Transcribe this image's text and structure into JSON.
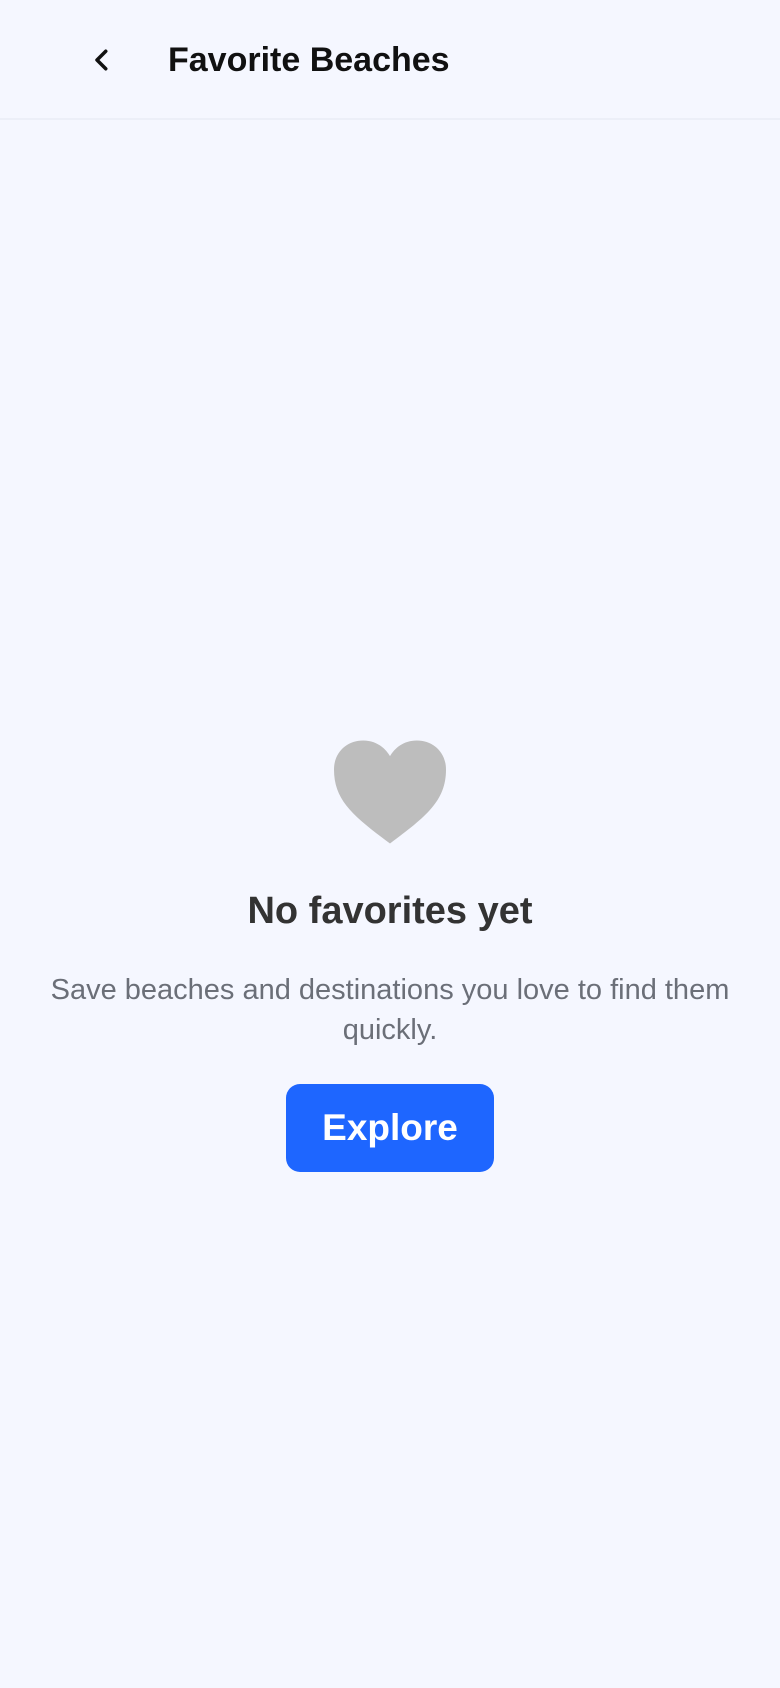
{
  "header": {
    "title": "Favorite Beaches",
    "back_icon": "chevron-left-icon"
  },
  "empty_state": {
    "icon": "heart-icon",
    "title": "No favorites yet",
    "message": "Save beaches and destinations you love to find them quickly.",
    "button_label": "Explore"
  },
  "colors": {
    "background": "#f5f7ff",
    "accent": "#1e66ff",
    "heart": "#bdbdbd",
    "title_text": "#333333",
    "body_text": "#6b6f78"
  }
}
